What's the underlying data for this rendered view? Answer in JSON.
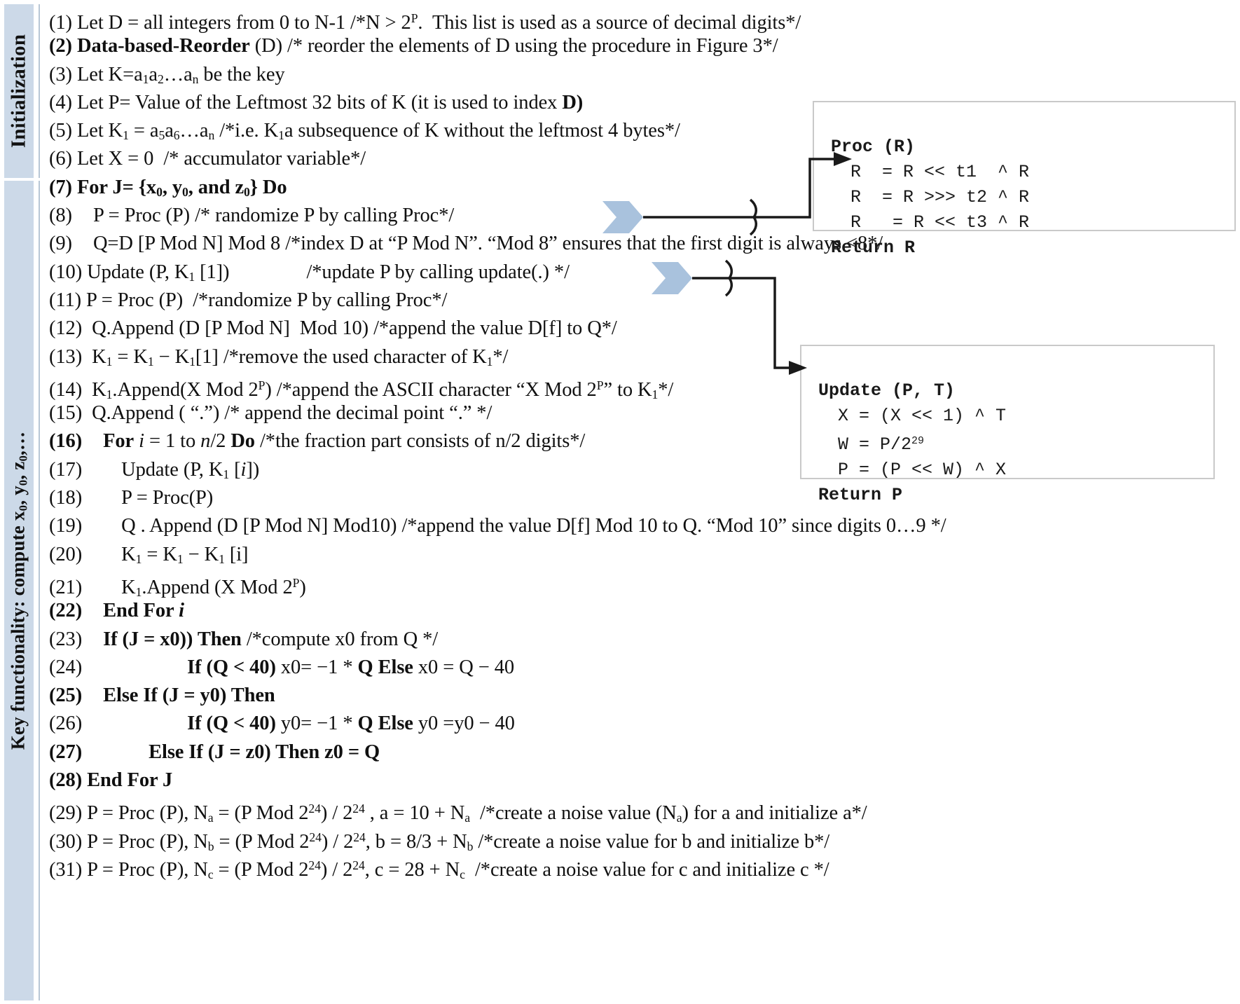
{
  "figure": {
    "sidebar": {
      "initialization_label": "Initialization",
      "key_functionality_label": "Key functionality: compute x0, y0, z0,…"
    },
    "code_boxes": {
      "proc": {
        "title": "Proc (R)",
        "lines": [
          "R  = R << t1  ^ R",
          "R  = R >>> t2 ^ R",
          "R   = R << t3 ^ R"
        ],
        "return": "Return R"
      },
      "update": {
        "title": "Update (P, T)",
        "lines": [
          "X = (X << 1) ^ T",
          "W = P/2²⁹",
          "P = (P << W) ^ X"
        ],
        "return": "Return P"
      }
    },
    "pseudocode": [
      {
        "n": "(1)",
        "text": "Let D = all integers from 0 to N-1 /*N > 2P.  This list is used as a source of decimal digits*/"
      },
      {
        "n": "(2)",
        "text": "Data-based-Reorder (D) /* reorder the elements of D using the procedure in Figure 3*/"
      },
      {
        "n": "(3)",
        "text": "Let K=a1a2…an be the key"
      },
      {
        "n": "(4)",
        "text": "Let P= Value of the Leftmost 32 bits of K (it is used to index D)"
      },
      {
        "n": "(5)",
        "text": "Let K1 = a5a6…an /*i.e. K1a subsequence of K without the leftmost 4 bytes*/"
      },
      {
        "n": "(6)",
        "text": "Let X = 0  /* accumulator variable*/"
      },
      {
        "n": "(7)",
        "text": "For J= {x0, y0, and z0} Do"
      },
      {
        "n": "(8)",
        "text": "P = Proc (P) /* randomize P by calling Proc*/"
      },
      {
        "n": "(9)",
        "text": "Q=D [P Mod N] Mod 8 /*index D at “P Mod N”. “Mod 8” ensures that the first digit is always <8*/"
      },
      {
        "n": "(10)",
        "text": "Update (P, K1 [1])          /*update P by calling update(.) */"
      },
      {
        "n": "(11)",
        "text": "P = Proc (P)  /*randomize P by calling Proc*/"
      },
      {
        "n": "(12)",
        "text": "Q.Append (D [P Mod N]  Mod 10) /*append the value D[f] to Q*/"
      },
      {
        "n": "(13)",
        "text": "K1 = K1 − K1[1] /*remove the used character of K1*/"
      },
      {
        "n": "(14)",
        "text": "K1.Append(X Mod 2P) /*append the ASCII character “X Mod 2P” to K1*/"
      },
      {
        "n": "(15)",
        "text": "Q.Append ( “.”) /* append the decimal point “.” */"
      },
      {
        "n": "(16)",
        "text": "For i = 1 to n/2 Do /*the fraction part consists of n/2 digits*/"
      },
      {
        "n": "(17)",
        "text": "Update (P, K1 [i])"
      },
      {
        "n": "(18)",
        "text": "P = Proc(P)"
      },
      {
        "n": "(19)",
        "text": "Q . Append (D [P Mod N] Mod10) /*append the value D[f] Mod 10 to Q. “Mod 10” since digits 0…9 */"
      },
      {
        "n": "(20)",
        "text": "K1 = K1 − K1 [i]"
      },
      {
        "n": "(21)",
        "text": "K1.Append (X Mod 2P)"
      },
      {
        "n": "(22)",
        "text": "End For i"
      },
      {
        "n": "(23)",
        "text": "If (J = x0)) Then /*compute x0 from Q */"
      },
      {
        "n": "(24)",
        "text": "If (Q < 40) x0= −1 * Q Else x0 = Q − 40"
      },
      {
        "n": "(25)",
        "text": "Else If (J = y0) Then"
      },
      {
        "n": "(26)",
        "text": "If (Q < 40) y0= −1 * Q Else y0 =y0 − 40"
      },
      {
        "n": "(27)",
        "text": "Else If (J = z0) Then z0 = Q"
      },
      {
        "n": "(28)",
        "text": "End For J"
      },
      {
        "n": "(29)",
        "text": "P = Proc (P), Na = (P Mod 224) / 224 , a = 10 + Na  /*create a noise value (Na) for a and initialize a*/"
      },
      {
        "n": "(30)",
        "text": "P = Proc (P), Nb = (P Mod 224) / 224, b = 8/3 + Nb /*create a noise value for b and initialize b*/"
      },
      {
        "n": "(31)",
        "text": "P = Proc (P), Nc = (P Mod 224) / 224, c = 28 + Nc  /*create a noise value for c and initialize c */"
      }
    ],
    "connectors": [
      {
        "name": "proc-call-connector",
        "from_line": "(8)",
        "to_box": "Proc (R)"
      },
      {
        "name": "update-call-connector",
        "from_line": "(10)",
        "to_box": "Update (P, T)"
      }
    ],
    "colors": {
      "sidebar_fill": "#ccd9e8",
      "chevron_fill": "#a9c2dd",
      "box_border": "#c9c9c9",
      "text": "#101010"
    }
  }
}
